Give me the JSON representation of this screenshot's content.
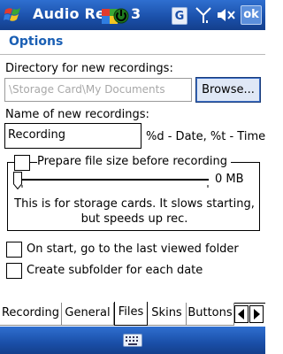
{
  "titlebar": {
    "app_title": "Audio Rec",
    "title_tail_digit": "3",
    "g_label": "G",
    "ok_label": "ok"
  },
  "header": {
    "title": "Options"
  },
  "directory": {
    "label": "Directory for new recordings:",
    "placeholder": "\\Storage Card\\My Documents",
    "browse_label": "Browse..."
  },
  "naming": {
    "label": "Name of new recordings:",
    "value": "Recording",
    "format_hint": "%d - Date, %t - Time"
  },
  "prepare": {
    "checkbox_label": "Prepare file size before recording",
    "checked": false,
    "slider_level": 0,
    "size_value": "0 MB",
    "note": "This is for storage cards. It slows starting, but speeds up rec."
  },
  "options": {
    "last_folder_label": "On start, go to the last viewed folder",
    "last_folder_checked": false,
    "subfolder_label": "Create subfolder for each date",
    "subfolder_checked": false
  },
  "tabs": {
    "items": [
      {
        "label": "Recording"
      },
      {
        "label": "General"
      },
      {
        "label": "Files"
      },
      {
        "label": "Skins"
      },
      {
        "label": "Buttons"
      }
    ],
    "active": "Files"
  },
  "icons": {
    "start": "windows-flag-icon",
    "signal": "signal-icon",
    "volume": "volume-muted-icon",
    "keyboard": "keyboard-icon",
    "power": "power-icon"
  },
  "colors": {
    "titlebar": "#1a4fa8",
    "header_text": "#1a5fb4"
  }
}
